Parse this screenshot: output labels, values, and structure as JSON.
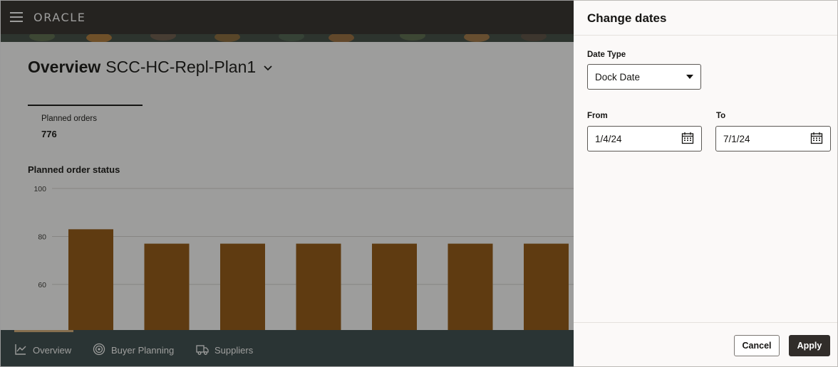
{
  "header": {
    "brand": "ORACLE"
  },
  "page": {
    "title_prefix": "Overview",
    "plan_name": "SCC-HC-Repl-Plan1"
  },
  "metric": {
    "label": "Planned orders",
    "value": "776"
  },
  "chart_data": {
    "type": "bar",
    "title": "Planned order status",
    "xlabel": "",
    "ylabel": "",
    "yticks": [
      100,
      80,
      60
    ],
    "ylim_visible": [
      41,
      100
    ],
    "grid": true,
    "values": [
      83,
      77,
      77,
      77,
      77,
      77,
      77
    ],
    "bar_color": "#945711"
  },
  "bottom_nav": {
    "items": [
      {
        "label": "Overview",
        "icon": "line-chart-icon",
        "active": true
      },
      {
        "label": "Buyer Planning",
        "icon": "target-icon",
        "active": false
      },
      {
        "label": "Suppliers",
        "icon": "truck-icon",
        "active": false
      }
    ]
  },
  "drawer": {
    "title": "Change dates",
    "date_type_label": "Date Type",
    "date_type_value": "Dock Date",
    "from_label": "From",
    "from_value": "1/4/24",
    "to_label": "To",
    "to_value": "7/1/24",
    "cancel_label": "Cancel",
    "apply_label": "Apply"
  },
  "colors": {
    "header_bg": "#312d2a",
    "nav_bg": "#3a4b4c",
    "bar": "#945711",
    "apply_bg": "#312d2a"
  }
}
